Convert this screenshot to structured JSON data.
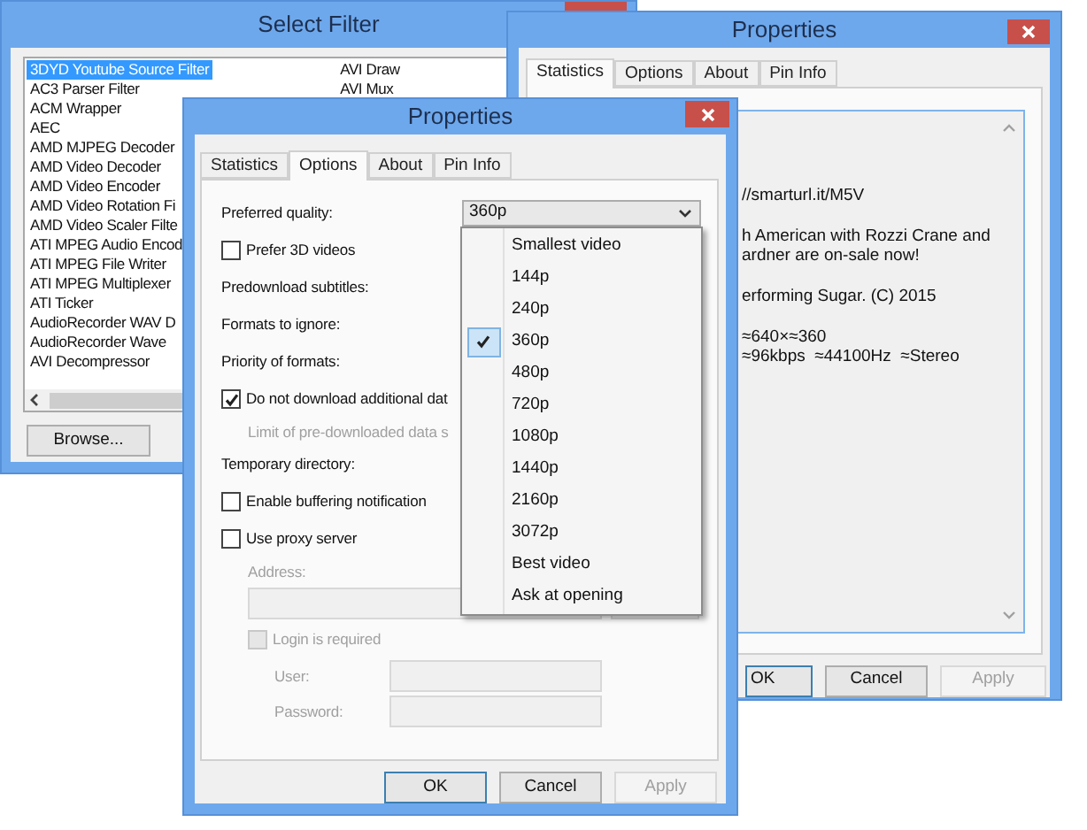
{
  "select_filter": {
    "title": "Select Filter",
    "filters_column_1": [
      {
        "label": "3DYD Youtube Source Filter",
        "selected": true
      },
      {
        "label": "AC3 Parser Filter",
        "selected": false
      },
      {
        "label": "ACM Wrapper",
        "selected": false
      },
      {
        "label": "AEC",
        "selected": false
      },
      {
        "label": "AMD MJPEG Decoder",
        "selected": false
      },
      {
        "label": "AMD Video Decoder",
        "selected": false
      },
      {
        "label": "AMD Video Encoder",
        "selected": false
      },
      {
        "label": "AMD Video Rotation Fi",
        "selected": false
      },
      {
        "label": "AMD Video Scaler Filte",
        "selected": false
      },
      {
        "label": "ATI MPEG Audio Encod",
        "selected": false
      },
      {
        "label": "ATI MPEG File Writer",
        "selected": false
      },
      {
        "label": "ATI MPEG Multiplexer",
        "selected": false
      },
      {
        "label": "ATI Ticker",
        "selected": false
      },
      {
        "label": "AudioRecorder WAV D",
        "selected": false
      },
      {
        "label": "AudioRecorder Wave",
        "selected": false
      },
      {
        "label": "AVI Decompressor",
        "selected": false
      }
    ],
    "filters_column_2": [
      {
        "label": "AVI Draw",
        "selected": false
      },
      {
        "label": "AVI Mux",
        "selected": false
      }
    ],
    "browse_button": "Browse..."
  },
  "properties_back": {
    "title": "Properties",
    "tabs": [
      {
        "label": "Statistics",
        "selected": true
      },
      {
        "label": "Options",
        "selected": false
      },
      {
        "label": "About",
        "selected": false
      },
      {
        "label": "Pin Info",
        "selected": false
      }
    ],
    "info_paragraphs": [
      [
        "//smarturl.it/M5V"
      ],
      [
        "h American with Rozzi Crane and",
        "ardner are on-sale now!"
      ],
      [
        "erforming Sugar. (C) 2015"
      ],
      [
        "≈640×≈360",
        "≈96kbps  ≈44100Hz  ≈Stereo"
      ]
    ],
    "buttons": [
      {
        "label": "OK",
        "default": true,
        "disabled": false
      },
      {
        "label": "Cancel",
        "default": false,
        "disabled": false
      },
      {
        "label": "Apply",
        "default": false,
        "disabled": true
      }
    ]
  },
  "properties_front": {
    "title": "Properties",
    "tabs": [
      {
        "label": "Statistics",
        "selected": false
      },
      {
        "label": "Options",
        "selected": true
      },
      {
        "label": "About",
        "selected": false
      },
      {
        "label": "Pin Info",
        "selected": false
      }
    ],
    "options": [
      {
        "kind": "combo",
        "label": "Preferred quality:",
        "value": "360p"
      },
      {
        "kind": "checkbox",
        "label": "Prefer 3D videos",
        "checked": false,
        "disabled": false
      },
      {
        "kind": "label",
        "label": "Predownload subtitles:"
      },
      {
        "kind": "label",
        "label": "Formats to ignore:"
      },
      {
        "kind": "label",
        "label": "Priority of formats:"
      },
      {
        "kind": "checkbox",
        "label": "Do not download additional dat",
        "checked": true,
        "disabled": false,
        "children": [
          {
            "kind": "note",
            "label": "Limit of pre-downloaded data s"
          }
        ]
      },
      {
        "kind": "label",
        "label": "Temporary directory:"
      },
      {
        "kind": "checkbox",
        "label": "Enable buffering notification",
        "checked": false,
        "disabled": false
      },
      {
        "kind": "checkbox",
        "label": "Use proxy server",
        "checked": false,
        "disabled": false,
        "children": [
          {
            "kind": "note",
            "label": "Address:"
          },
          {
            "kind": "address_fields",
            "disabled": true
          },
          {
            "kind": "checkbox",
            "label": "Login is required",
            "checked": false,
            "disabled": true,
            "children": [
              {
                "kind": "labeled_input",
                "label": "User:",
                "disabled": true
              },
              {
                "kind": "labeled_input",
                "label": "Password:",
                "disabled": true
              }
            ]
          }
        ]
      }
    ],
    "quality_menu": [
      {
        "label": "Smallest video",
        "selected": false
      },
      {
        "label": "144p",
        "selected": false
      },
      {
        "label": "240p",
        "selected": false
      },
      {
        "label": "360p",
        "selected": true
      },
      {
        "label": "480p",
        "selected": false
      },
      {
        "label": "720p",
        "selected": false
      },
      {
        "label": "1080p",
        "selected": false
      },
      {
        "label": "1440p",
        "selected": false
      },
      {
        "label": "2160p",
        "selected": false
      },
      {
        "label": "3072p",
        "selected": false
      },
      {
        "label": "Best video",
        "selected": false
      },
      {
        "label": "Ask at opening",
        "selected": false
      }
    ],
    "buttons": [
      {
        "label": "OK",
        "default": true,
        "disabled": false
      },
      {
        "label": "Cancel",
        "default": false,
        "disabled": false
      },
      {
        "label": "Apply",
        "default": false,
        "disabled": true
      }
    ]
  }
}
